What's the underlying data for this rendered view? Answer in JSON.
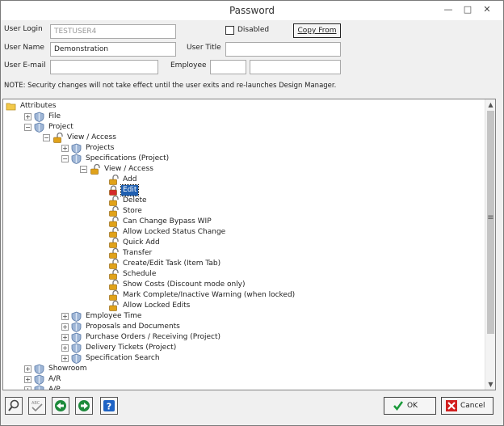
{
  "window": {
    "title": "Password"
  },
  "form": {
    "user_login_label": "User Login",
    "user_login_value": "TESTUSER4",
    "disabled_label": "Disabled",
    "copy_from_label": "Copy From",
    "user_name_label": "User Name",
    "user_name_value": "Demonstration",
    "user_title_label": "User Title",
    "user_title_value": "",
    "user_email_label": "User E-mail",
    "user_email_value": "",
    "employee_label": "Employee",
    "employee_code": "",
    "employee_name": ""
  },
  "note": "NOTE: Security changes will not take effect until the user exits and re-launches Design Manager.",
  "tree": {
    "items": [
      {
        "label": "Attributes",
        "level": 0,
        "icon": "folder-icon",
        "expander": "none"
      },
      {
        "label": "File",
        "level": 1,
        "icon": "shield-icon",
        "expander": "+"
      },
      {
        "label": "Project",
        "level": 1,
        "icon": "shield-icon",
        "expander": "-"
      },
      {
        "label": "View / Access",
        "level": 2,
        "icon": "lock-open-icon",
        "expander": "-"
      },
      {
        "label": "Projects",
        "level": 3,
        "icon": "shield-icon",
        "expander": "+"
      },
      {
        "label": "Specifications (Project)",
        "level": 3,
        "icon": "shield-icon",
        "expander": "-"
      },
      {
        "label": "View / Access",
        "level": 4,
        "icon": "lock-open-icon",
        "expander": "-"
      },
      {
        "label": "Add",
        "level": 5,
        "icon": "lock-open-icon",
        "expander": "none"
      },
      {
        "label": "Edit",
        "level": 5,
        "icon": "lock-closed-icon",
        "expander": "none",
        "selected": true
      },
      {
        "label": "Delete",
        "level": 5,
        "icon": "lock-open-icon",
        "expander": "none"
      },
      {
        "label": "Store",
        "level": 5,
        "icon": "lock-open-icon",
        "expander": "none"
      },
      {
        "label": "Can Change Bypass WIP",
        "level": 5,
        "icon": "lock-open-icon",
        "expander": "none"
      },
      {
        "label": "Allow Locked Status Change",
        "level": 5,
        "icon": "lock-open-icon",
        "expander": "none"
      },
      {
        "label": "Quick Add",
        "level": 5,
        "icon": "lock-open-icon",
        "expander": "none"
      },
      {
        "label": "Transfer",
        "level": 5,
        "icon": "lock-open-icon",
        "expander": "none"
      },
      {
        "label": "Create/Edit Task (Item Tab)",
        "level": 5,
        "icon": "lock-open-icon",
        "expander": "none"
      },
      {
        "label": "Schedule",
        "level": 5,
        "icon": "lock-open-icon",
        "expander": "none"
      },
      {
        "label": "Show Costs (Discount mode only)",
        "level": 5,
        "icon": "lock-open-icon",
        "expander": "none"
      },
      {
        "label": "Mark Complete/Inactive Warning (when locked)",
        "level": 5,
        "icon": "lock-open-icon",
        "expander": "none"
      },
      {
        "label": "Allow Locked Edits",
        "level": 5,
        "icon": "lock-open-icon",
        "expander": "none"
      },
      {
        "label": "Employee Time",
        "level": 3,
        "icon": "shield-icon",
        "expander": "+"
      },
      {
        "label": "Proposals and Documents",
        "level": 3,
        "icon": "shield-icon",
        "expander": "+"
      },
      {
        "label": "Purchase Orders / Receiving (Project)",
        "level": 3,
        "icon": "shield-icon",
        "expander": "+"
      },
      {
        "label": "Delivery Tickets (Project)",
        "level": 3,
        "icon": "shield-icon",
        "expander": "+"
      },
      {
        "label": "Specification Search",
        "level": 3,
        "icon": "shield-icon",
        "expander": "+"
      },
      {
        "label": "Showroom",
        "level": 1,
        "icon": "shield-icon",
        "expander": "+"
      },
      {
        "label": "A/R",
        "level": 1,
        "icon": "shield-icon",
        "expander": "+"
      },
      {
        "label": "A/P",
        "level": 1,
        "icon": "shield-icon",
        "expander": "+"
      }
    ]
  },
  "scrollbar": {
    "grip": "≡"
  },
  "buttons": {
    "ok": "OK",
    "cancel": "Cancel"
  },
  "colors": {
    "selection": "#1f5fb0",
    "ok_check": "#1a9a3a",
    "cancel_x": "#d21f1f",
    "lock_gold": "#e0a21a",
    "lock_red": "#d42a2a",
    "nav_green": "#1d8a3b",
    "help_blue": "#1e63c4"
  }
}
